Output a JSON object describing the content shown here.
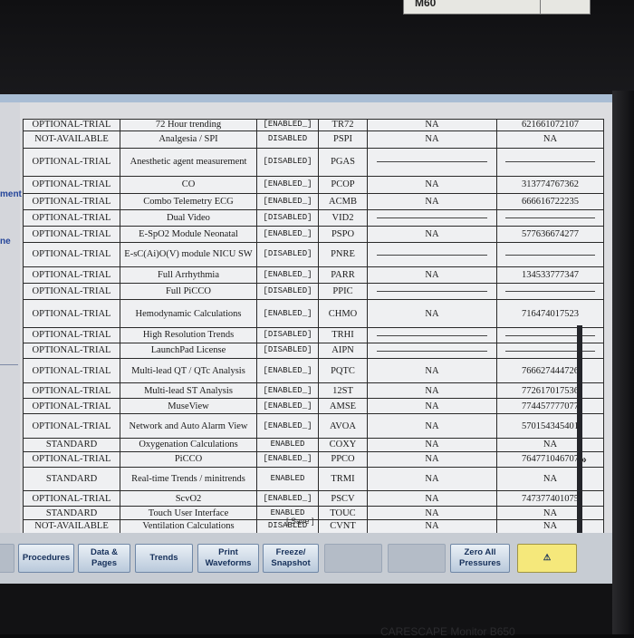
{
  "top_readout": "M60",
  "side_labels": [
    "ment",
    "ne"
  ],
  "table": {
    "rows": [
      {
        "status": "OPTIONAL-TRIAL",
        "feature": "72 Hour trending",
        "state": "[ENABLED_]",
        "code": "TR72",
        "c1": "NA",
        "c2": "621661072107"
      },
      {
        "status": "NOT-AVAILABLE",
        "feature": "Analgesia / SPI",
        "state": "DISABLED",
        "code": "PSPI",
        "c1": "NA",
        "c2": "NA"
      },
      {
        "status": "OPTIONAL-TRIAL",
        "feature": "Anesthetic agent measurement",
        "state": "[DISABLED]",
        "code": "PGAS",
        "c1": "",
        "c2": ""
      },
      {
        "status": "OPTIONAL-TRIAL",
        "feature": "CO",
        "state": "[ENABLED_]",
        "code": "PCOP",
        "c1": "NA",
        "c2": "313774767362"
      },
      {
        "status": "OPTIONAL-TRIAL",
        "feature": "Combo Telemetry ECG",
        "state": "[ENABLED_]",
        "code": "ACMB",
        "c1": "NA",
        "c2": "666616722235"
      },
      {
        "status": "OPTIONAL-TRIAL",
        "feature": "Dual Video",
        "state": "[DISABLED]",
        "code": "VID2",
        "c1": "",
        "c2": ""
      },
      {
        "status": "OPTIONAL-TRIAL",
        "feature": "E-SpO2 Module Neonatal",
        "state": "[ENABLED_]",
        "code": "PSPO",
        "c1": "NA",
        "c2": "577636674277"
      },
      {
        "status": "OPTIONAL-TRIAL",
        "feature": "E-sC(Ai)O(V) module NICU SW",
        "state": "[DISABLED]",
        "code": "PNRE",
        "c1": "",
        "c2": ""
      },
      {
        "status": "OPTIONAL-TRIAL",
        "feature": "Full Arrhythmia",
        "state": "[ENABLED_]",
        "code": "PARR",
        "c1": "NA",
        "c2": "134533777347"
      },
      {
        "status": "OPTIONAL-TRIAL",
        "feature": "Full PiCCO",
        "state": "[DISABLED]",
        "code": "PPIC",
        "c1": "",
        "c2": ""
      },
      {
        "status": "OPTIONAL-TRIAL",
        "feature": "Hemodynamic Calculations",
        "state": "[ENABLED_]",
        "code": "CHMO",
        "c1": "NA",
        "c2": "716474017523"
      },
      {
        "status": "OPTIONAL-TRIAL",
        "feature": "High Resolution Trends",
        "state": "[DISABLED]",
        "code": "TRHI",
        "c1": "",
        "c2": ""
      },
      {
        "status": "OPTIONAL-TRIAL",
        "feature": "LaunchPad License",
        "state": "[DISABLED]",
        "code": "AIPN",
        "c1": "",
        "c2": ""
      },
      {
        "status": "OPTIONAL-TRIAL",
        "feature": "Multi-lead QT / QTc Analysis",
        "state": "[ENABLED_]",
        "code": "PQTC",
        "c1": "NA",
        "c2": "766627444726"
      },
      {
        "status": "OPTIONAL-TRIAL",
        "feature": "Multi-lead ST Analysis",
        "state": "[ENABLED_]",
        "code": "12ST",
        "c1": "NA",
        "c2": "772617017536"
      },
      {
        "status": "OPTIONAL-TRIAL",
        "feature": "MuseView",
        "state": "[ENABLED_]",
        "code": "AMSE",
        "c1": "NA",
        "c2": "774457777077"
      },
      {
        "status": "OPTIONAL-TRIAL",
        "feature": "Network and Auto Alarm View",
        "state": "[ENABLED_]",
        "code": "AVOA",
        "c1": "NA",
        "c2": "570154345401"
      },
      {
        "status": "STANDARD",
        "feature": "Oxygenation Calculations",
        "state": "ENABLED",
        "code": "COXY",
        "c1": "NA",
        "c2": "NA"
      },
      {
        "status": "OPTIONAL-TRIAL",
        "feature": "PiCCO",
        "state": "[ENABLED_]",
        "code": "PPCO",
        "c1": "NA",
        "c2": "764771046707"
      },
      {
        "status": "STANDARD",
        "feature": "Real-time Trends / minitrends",
        "state": "ENABLED",
        "code": "TRMI",
        "c1": "NA",
        "c2": "NA"
      },
      {
        "status": "OPTIONAL-TRIAL",
        "feature": "ScvO2",
        "state": "[ENABLED_]",
        "code": "PSCV",
        "c1": "NA",
        "c2": "747377401075"
      },
      {
        "status": "STANDARD",
        "feature": "Touch User Interface",
        "state": "ENABLED",
        "code": "TOUC",
        "c1": "NA",
        "c2": "NA"
      },
      {
        "status": "NOT-AVAILABLE",
        "feature": "Ventilation Calculations",
        "state": "DISABLED",
        "code": "CVNT",
        "c1": "NA",
        "c2": "NA"
      }
    ]
  },
  "save_label": "[ Save ]",
  "scroll_mark": "»",
  "softkeys": [
    {
      "label": "",
      "name": "blank"
    },
    {
      "label": "Procedures",
      "name": "procedures"
    },
    {
      "label": "Data &\nPages",
      "name": "data-pages"
    },
    {
      "label": "Trends",
      "name": "trends"
    },
    {
      "label": "Print\nWaveforms",
      "name": "print-waveforms"
    },
    {
      "label": "Freeze/\nSnapshot",
      "name": "freeze-snapshot"
    },
    {
      "label": "",
      "name": "disabled-1"
    },
    {
      "label": "",
      "name": "disabled-2"
    },
    {
      "label": "Zero All\nPressures",
      "name": "zero-all-pressures"
    },
    {
      "label": "⚠",
      "name": "alarm"
    }
  ],
  "brand": "CARESCAPE Monitor B650",
  "colors": {
    "accent": "#24459a",
    "alarm": "#f5e87b",
    "softkey_text": "#16305a"
  }
}
